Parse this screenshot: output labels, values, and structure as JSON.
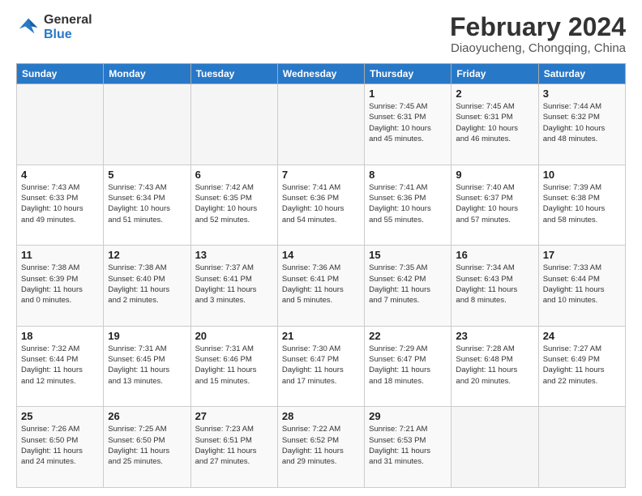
{
  "logo": {
    "line1": "General",
    "line2": "Blue"
  },
  "title": "February 2024",
  "subtitle": "Diaoyucheng, Chongqing, China",
  "weekdays": [
    "Sunday",
    "Monday",
    "Tuesday",
    "Wednesday",
    "Thursday",
    "Friday",
    "Saturday"
  ],
  "weeks": [
    [
      {
        "day": "",
        "info": ""
      },
      {
        "day": "",
        "info": ""
      },
      {
        "day": "",
        "info": ""
      },
      {
        "day": "",
        "info": ""
      },
      {
        "day": "1",
        "info": "Sunrise: 7:45 AM\nSunset: 6:31 PM\nDaylight: 10 hours\nand 45 minutes."
      },
      {
        "day": "2",
        "info": "Sunrise: 7:45 AM\nSunset: 6:31 PM\nDaylight: 10 hours\nand 46 minutes."
      },
      {
        "day": "3",
        "info": "Sunrise: 7:44 AM\nSunset: 6:32 PM\nDaylight: 10 hours\nand 48 minutes."
      }
    ],
    [
      {
        "day": "4",
        "info": "Sunrise: 7:43 AM\nSunset: 6:33 PM\nDaylight: 10 hours\nand 49 minutes."
      },
      {
        "day": "5",
        "info": "Sunrise: 7:43 AM\nSunset: 6:34 PM\nDaylight: 10 hours\nand 51 minutes."
      },
      {
        "day": "6",
        "info": "Sunrise: 7:42 AM\nSunset: 6:35 PM\nDaylight: 10 hours\nand 52 minutes."
      },
      {
        "day": "7",
        "info": "Sunrise: 7:41 AM\nSunset: 6:36 PM\nDaylight: 10 hours\nand 54 minutes."
      },
      {
        "day": "8",
        "info": "Sunrise: 7:41 AM\nSunset: 6:36 PM\nDaylight: 10 hours\nand 55 minutes."
      },
      {
        "day": "9",
        "info": "Sunrise: 7:40 AM\nSunset: 6:37 PM\nDaylight: 10 hours\nand 57 minutes."
      },
      {
        "day": "10",
        "info": "Sunrise: 7:39 AM\nSunset: 6:38 PM\nDaylight: 10 hours\nand 58 minutes."
      }
    ],
    [
      {
        "day": "11",
        "info": "Sunrise: 7:38 AM\nSunset: 6:39 PM\nDaylight: 11 hours\nand 0 minutes."
      },
      {
        "day": "12",
        "info": "Sunrise: 7:38 AM\nSunset: 6:40 PM\nDaylight: 11 hours\nand 2 minutes."
      },
      {
        "day": "13",
        "info": "Sunrise: 7:37 AM\nSunset: 6:41 PM\nDaylight: 11 hours\nand 3 minutes."
      },
      {
        "day": "14",
        "info": "Sunrise: 7:36 AM\nSunset: 6:41 PM\nDaylight: 11 hours\nand 5 minutes."
      },
      {
        "day": "15",
        "info": "Sunrise: 7:35 AM\nSunset: 6:42 PM\nDaylight: 11 hours\nand 7 minutes."
      },
      {
        "day": "16",
        "info": "Sunrise: 7:34 AM\nSunset: 6:43 PM\nDaylight: 11 hours\nand 8 minutes."
      },
      {
        "day": "17",
        "info": "Sunrise: 7:33 AM\nSunset: 6:44 PM\nDaylight: 11 hours\nand 10 minutes."
      }
    ],
    [
      {
        "day": "18",
        "info": "Sunrise: 7:32 AM\nSunset: 6:44 PM\nDaylight: 11 hours\nand 12 minutes."
      },
      {
        "day": "19",
        "info": "Sunrise: 7:31 AM\nSunset: 6:45 PM\nDaylight: 11 hours\nand 13 minutes."
      },
      {
        "day": "20",
        "info": "Sunrise: 7:31 AM\nSunset: 6:46 PM\nDaylight: 11 hours\nand 15 minutes."
      },
      {
        "day": "21",
        "info": "Sunrise: 7:30 AM\nSunset: 6:47 PM\nDaylight: 11 hours\nand 17 minutes."
      },
      {
        "day": "22",
        "info": "Sunrise: 7:29 AM\nSunset: 6:47 PM\nDaylight: 11 hours\nand 18 minutes."
      },
      {
        "day": "23",
        "info": "Sunrise: 7:28 AM\nSunset: 6:48 PM\nDaylight: 11 hours\nand 20 minutes."
      },
      {
        "day": "24",
        "info": "Sunrise: 7:27 AM\nSunset: 6:49 PM\nDaylight: 11 hours\nand 22 minutes."
      }
    ],
    [
      {
        "day": "25",
        "info": "Sunrise: 7:26 AM\nSunset: 6:50 PM\nDaylight: 11 hours\nand 24 minutes."
      },
      {
        "day": "26",
        "info": "Sunrise: 7:25 AM\nSunset: 6:50 PM\nDaylight: 11 hours\nand 25 minutes."
      },
      {
        "day": "27",
        "info": "Sunrise: 7:23 AM\nSunset: 6:51 PM\nDaylight: 11 hours\nand 27 minutes."
      },
      {
        "day": "28",
        "info": "Sunrise: 7:22 AM\nSunset: 6:52 PM\nDaylight: 11 hours\nand 29 minutes."
      },
      {
        "day": "29",
        "info": "Sunrise: 7:21 AM\nSunset: 6:53 PM\nDaylight: 11 hours\nand 31 minutes."
      },
      {
        "day": "",
        "info": ""
      },
      {
        "day": "",
        "info": ""
      }
    ]
  ]
}
